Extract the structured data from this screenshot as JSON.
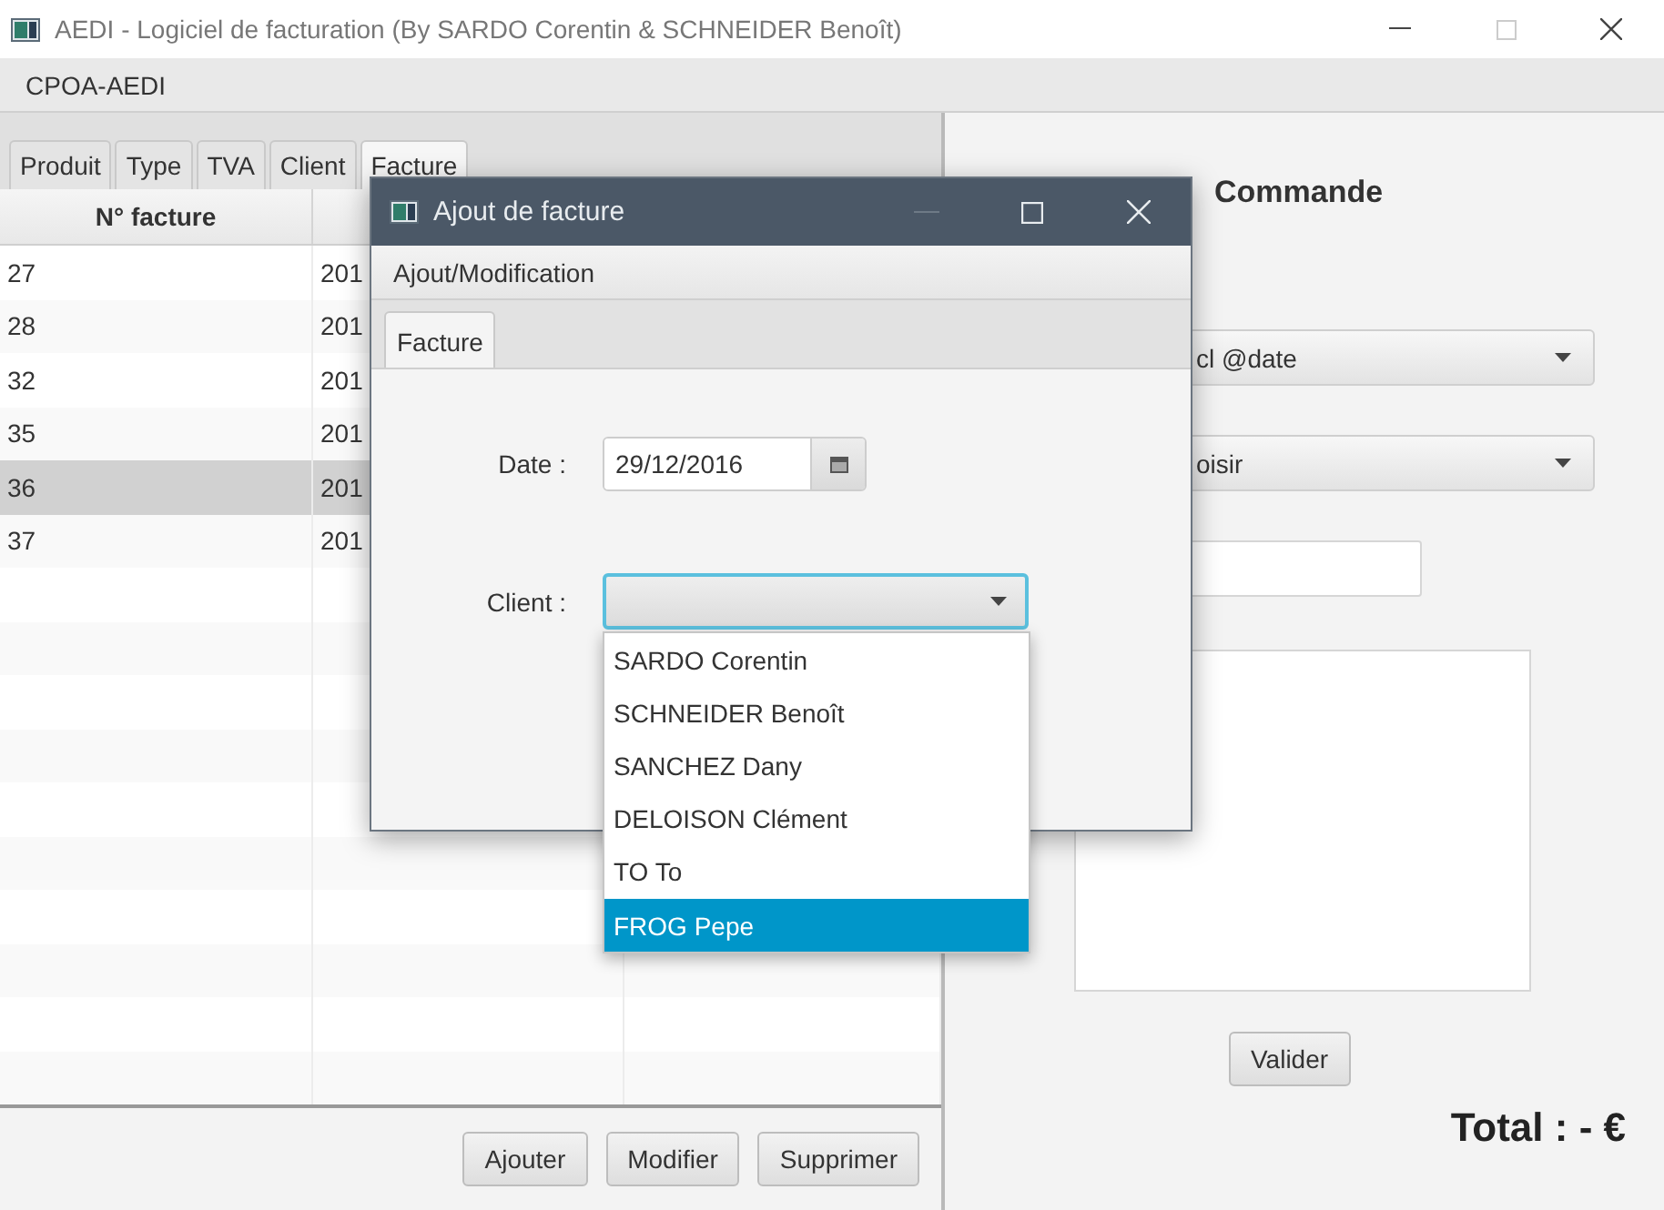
{
  "window": {
    "title": "AEDI - Logiciel de facturation (By SARDO Corentin & SCHNEIDER Benoît)"
  },
  "menu": [
    "CPOA-AEDI"
  ],
  "tabs": [
    {
      "label": "Produit",
      "selected": false
    },
    {
      "label": "Type",
      "selected": false
    },
    {
      "label": "TVA",
      "selected": false
    },
    {
      "label": "Client",
      "selected": false
    },
    {
      "label": "Facture",
      "selected": true
    }
  ],
  "table": {
    "columns": [
      "N° facture"
    ],
    "rows": [
      {
        "cells": [
          "27",
          "201"
        ],
        "selected": false
      },
      {
        "cells": [
          "28",
          "201"
        ],
        "selected": false
      },
      {
        "cells": [
          "32",
          "201"
        ],
        "selected": false
      },
      {
        "cells": [
          "35",
          "201"
        ],
        "selected": false
      },
      {
        "cells": [
          "36",
          "201"
        ],
        "selected": true
      },
      {
        "cells": [
          "37",
          "201"
        ],
        "selected": false
      }
    ]
  },
  "buttons": [
    "Ajouter",
    "Modifier",
    "Supprimer"
  ],
  "order_panel": {
    "title": "Commande",
    "combos": [
      "cl @date",
      "oisir"
    ],
    "button": "Valider",
    "total": "Total : - €"
  },
  "dialog": {
    "title": "Ajout de facture",
    "menu": [
      "Ajout/Modification"
    ],
    "tabs": [
      {
        "label": "Facture",
        "selected": true
      }
    ],
    "date_label": "Date :",
    "date_value": "29/12/2016",
    "client_label": "Client :",
    "client_options": [
      {
        "label": "SARDO Corentin",
        "selected": false
      },
      {
        "label": "SCHNEIDER Benoît",
        "selected": false
      },
      {
        "label": "SANCHEZ Dany",
        "selected": false
      },
      {
        "label": "DELOISON Clément",
        "selected": false
      },
      {
        "label": "TO To",
        "selected": false
      },
      {
        "label": "FROG Pepe",
        "selected": true
      }
    ]
  }
}
